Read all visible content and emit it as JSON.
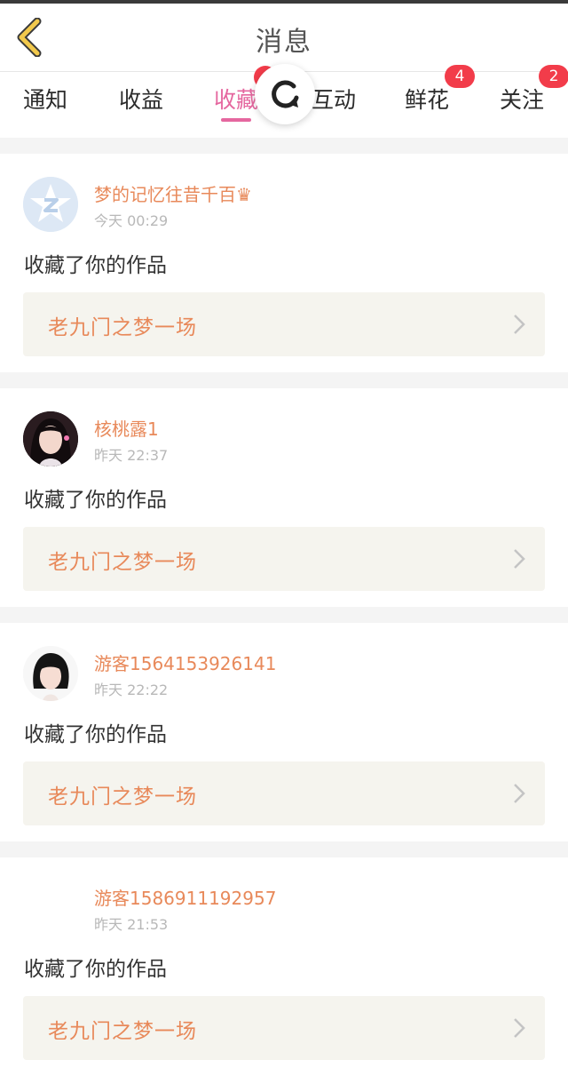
{
  "header": {
    "title": "消息",
    "back_icon": "chevron-left-icon",
    "back_color": "#f2c94c"
  },
  "tabs": [
    {
      "label": "通知",
      "active": false
    },
    {
      "label": "收益",
      "active": false
    },
    {
      "label": "收藏",
      "active": true
    },
    {
      "label": "互动",
      "active": false
    },
    {
      "label": "鲜花",
      "active": false,
      "badge": "4"
    },
    {
      "label": "关注",
      "active": false,
      "badge": "2"
    }
  ],
  "refresh": {
    "icon": "refresh-icon"
  },
  "colors": {
    "accent": "#e5679f",
    "username": "#e8895a",
    "badge": "#f23c4a",
    "work_bg": "#f5f4ee"
  },
  "messages": [
    {
      "username": "梦的记忆往昔千百♛",
      "time": "今天 00:29",
      "action": "收藏了你的作品",
      "work": "老九门之梦一场",
      "avatar": "default-star-avatar"
    },
    {
      "username": "核桃露1",
      "time": "昨天 22:37",
      "action": "收藏了你的作品",
      "work": "老九门之梦一场",
      "avatar": "photo-avatar-girl"
    },
    {
      "username": "游客1564153926141",
      "time": "昨天 22:22",
      "action": "收藏了你的作品",
      "work": "老九门之梦一场",
      "avatar": "photo-avatar-bob-hair"
    },
    {
      "username": "游客1586911192957",
      "time": "昨天 21:53",
      "action": "收藏了你的作品",
      "work": "老九门之梦一场",
      "avatar": "empty-avatar"
    }
  ]
}
